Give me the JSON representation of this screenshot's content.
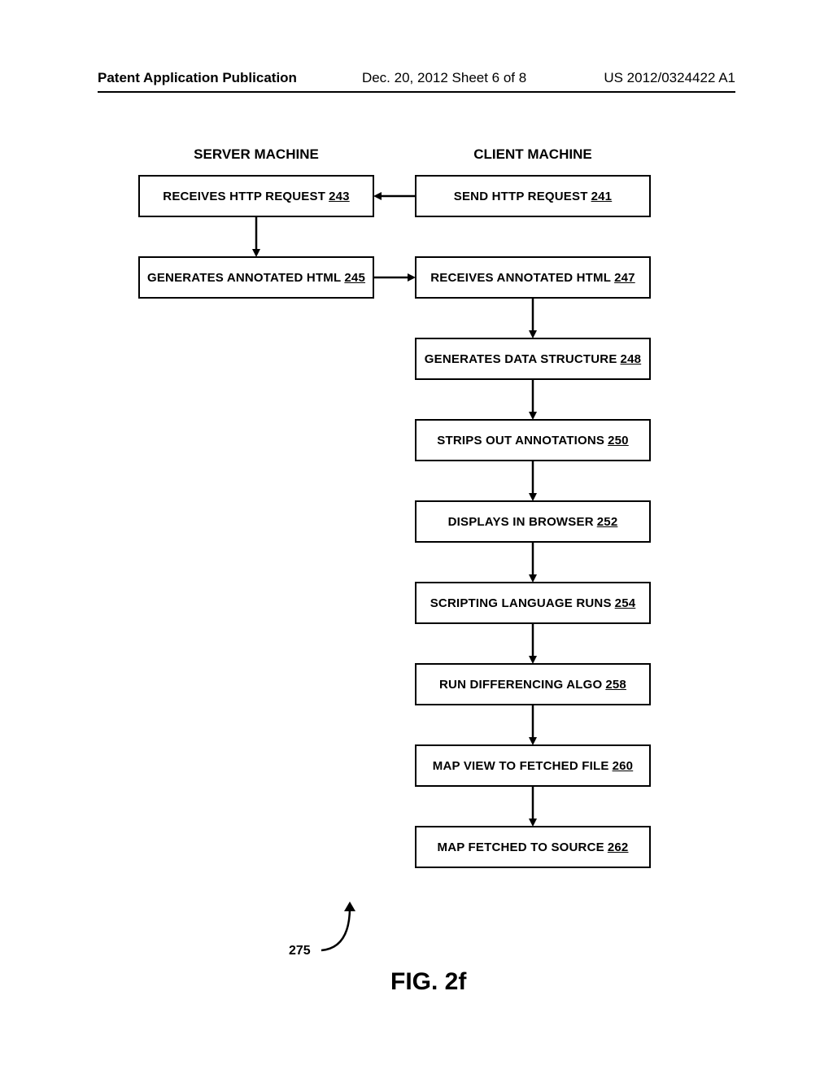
{
  "header": {
    "left": "Patent Application Publication",
    "mid": "Dec. 20, 2012  Sheet 6 of 8",
    "right": "US 2012/0324422 A1"
  },
  "columns": {
    "server": "SERVER MACHINE",
    "client": "CLIENT MACHINE"
  },
  "boxes": {
    "b241": {
      "label": "SEND HTTP REQUEST",
      "num": "241"
    },
    "b243": {
      "label": "RECEIVES HTTP REQUEST",
      "num": "243"
    },
    "b245": {
      "label": "GENERATES ANNOTATED HTML",
      "num": "245"
    },
    "b247": {
      "label": "RECEIVES ANNOTATED HTML",
      "num": "247"
    },
    "b248": {
      "label": "GENERATES DATA STRUCTURE",
      "num": "248"
    },
    "b250": {
      "label": "STRIPS OUT ANNOTATIONS",
      "num": "250"
    },
    "b252": {
      "label": "DISPLAYS IN BROWSER",
      "num": "252"
    },
    "b254": {
      "label": "SCRIPTING LANGUAGE RUNS",
      "num": "254"
    },
    "b258": {
      "label": "RUN DIFFERENCING ALGO",
      "num": "258"
    },
    "b260": {
      "label": "MAP VIEW TO FETCHED FILE",
      "num": "260"
    },
    "b262": {
      "label": "MAP FETCHED TO SOURCE",
      "num": "262"
    }
  },
  "ref": {
    "num": "275"
  },
  "figure": {
    "label": "FIG. 2f"
  }
}
